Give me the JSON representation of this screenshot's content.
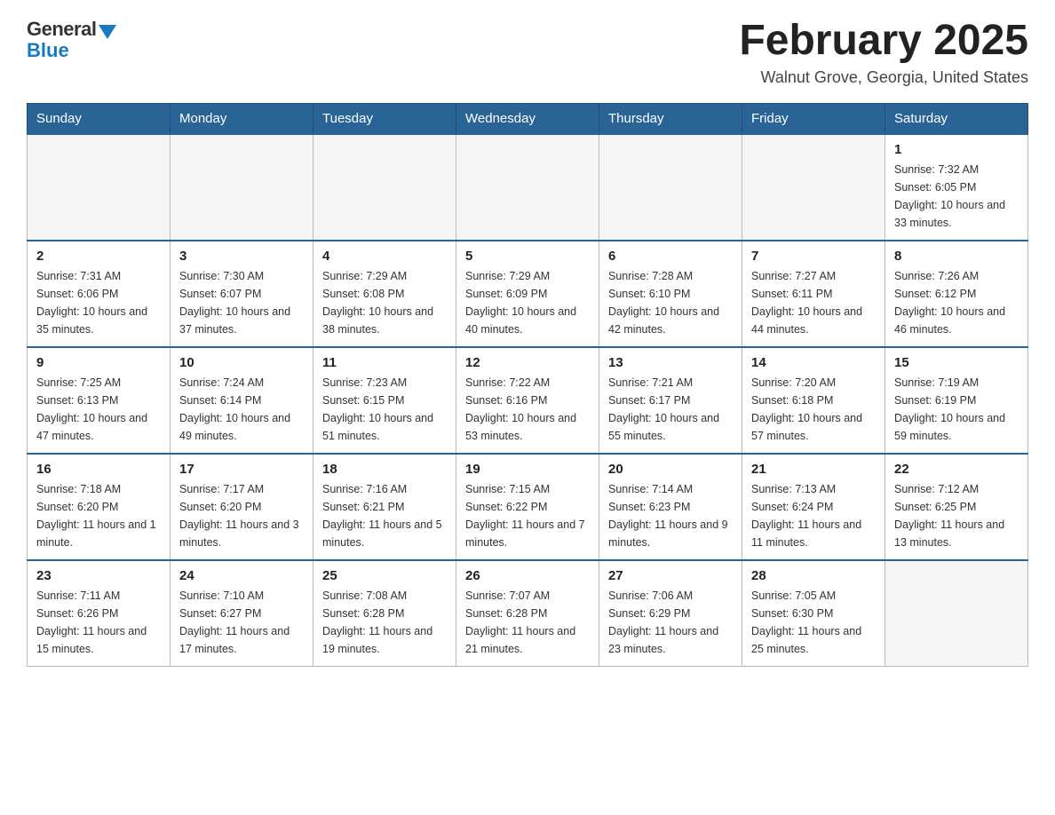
{
  "logo": {
    "general": "General",
    "blue": "Blue"
  },
  "title": "February 2025",
  "location": "Walnut Grove, Georgia, United States",
  "days_of_week": [
    "Sunday",
    "Monday",
    "Tuesday",
    "Wednesday",
    "Thursday",
    "Friday",
    "Saturday"
  ],
  "weeks": [
    [
      {
        "day": "",
        "info": ""
      },
      {
        "day": "",
        "info": ""
      },
      {
        "day": "",
        "info": ""
      },
      {
        "day": "",
        "info": ""
      },
      {
        "day": "",
        "info": ""
      },
      {
        "day": "",
        "info": ""
      },
      {
        "day": "1",
        "info": "Sunrise: 7:32 AM\nSunset: 6:05 PM\nDaylight: 10 hours and 33 minutes."
      }
    ],
    [
      {
        "day": "2",
        "info": "Sunrise: 7:31 AM\nSunset: 6:06 PM\nDaylight: 10 hours and 35 minutes."
      },
      {
        "day": "3",
        "info": "Sunrise: 7:30 AM\nSunset: 6:07 PM\nDaylight: 10 hours and 37 minutes."
      },
      {
        "day": "4",
        "info": "Sunrise: 7:29 AM\nSunset: 6:08 PM\nDaylight: 10 hours and 38 minutes."
      },
      {
        "day": "5",
        "info": "Sunrise: 7:29 AM\nSunset: 6:09 PM\nDaylight: 10 hours and 40 minutes."
      },
      {
        "day": "6",
        "info": "Sunrise: 7:28 AM\nSunset: 6:10 PM\nDaylight: 10 hours and 42 minutes."
      },
      {
        "day": "7",
        "info": "Sunrise: 7:27 AM\nSunset: 6:11 PM\nDaylight: 10 hours and 44 minutes."
      },
      {
        "day": "8",
        "info": "Sunrise: 7:26 AM\nSunset: 6:12 PM\nDaylight: 10 hours and 46 minutes."
      }
    ],
    [
      {
        "day": "9",
        "info": "Sunrise: 7:25 AM\nSunset: 6:13 PM\nDaylight: 10 hours and 47 minutes."
      },
      {
        "day": "10",
        "info": "Sunrise: 7:24 AM\nSunset: 6:14 PM\nDaylight: 10 hours and 49 minutes."
      },
      {
        "day": "11",
        "info": "Sunrise: 7:23 AM\nSunset: 6:15 PM\nDaylight: 10 hours and 51 minutes."
      },
      {
        "day": "12",
        "info": "Sunrise: 7:22 AM\nSunset: 6:16 PM\nDaylight: 10 hours and 53 minutes."
      },
      {
        "day": "13",
        "info": "Sunrise: 7:21 AM\nSunset: 6:17 PM\nDaylight: 10 hours and 55 minutes."
      },
      {
        "day": "14",
        "info": "Sunrise: 7:20 AM\nSunset: 6:18 PM\nDaylight: 10 hours and 57 minutes."
      },
      {
        "day": "15",
        "info": "Sunrise: 7:19 AM\nSunset: 6:19 PM\nDaylight: 10 hours and 59 minutes."
      }
    ],
    [
      {
        "day": "16",
        "info": "Sunrise: 7:18 AM\nSunset: 6:20 PM\nDaylight: 11 hours and 1 minute."
      },
      {
        "day": "17",
        "info": "Sunrise: 7:17 AM\nSunset: 6:20 PM\nDaylight: 11 hours and 3 minutes."
      },
      {
        "day": "18",
        "info": "Sunrise: 7:16 AM\nSunset: 6:21 PM\nDaylight: 11 hours and 5 minutes."
      },
      {
        "day": "19",
        "info": "Sunrise: 7:15 AM\nSunset: 6:22 PM\nDaylight: 11 hours and 7 minutes."
      },
      {
        "day": "20",
        "info": "Sunrise: 7:14 AM\nSunset: 6:23 PM\nDaylight: 11 hours and 9 minutes."
      },
      {
        "day": "21",
        "info": "Sunrise: 7:13 AM\nSunset: 6:24 PM\nDaylight: 11 hours and 11 minutes."
      },
      {
        "day": "22",
        "info": "Sunrise: 7:12 AM\nSunset: 6:25 PM\nDaylight: 11 hours and 13 minutes."
      }
    ],
    [
      {
        "day": "23",
        "info": "Sunrise: 7:11 AM\nSunset: 6:26 PM\nDaylight: 11 hours and 15 minutes."
      },
      {
        "day": "24",
        "info": "Sunrise: 7:10 AM\nSunset: 6:27 PM\nDaylight: 11 hours and 17 minutes."
      },
      {
        "day": "25",
        "info": "Sunrise: 7:08 AM\nSunset: 6:28 PM\nDaylight: 11 hours and 19 minutes."
      },
      {
        "day": "26",
        "info": "Sunrise: 7:07 AM\nSunset: 6:28 PM\nDaylight: 11 hours and 21 minutes."
      },
      {
        "day": "27",
        "info": "Sunrise: 7:06 AM\nSunset: 6:29 PM\nDaylight: 11 hours and 23 minutes."
      },
      {
        "day": "28",
        "info": "Sunrise: 7:05 AM\nSunset: 6:30 PM\nDaylight: 11 hours and 25 minutes."
      },
      {
        "day": "",
        "info": ""
      }
    ]
  ]
}
